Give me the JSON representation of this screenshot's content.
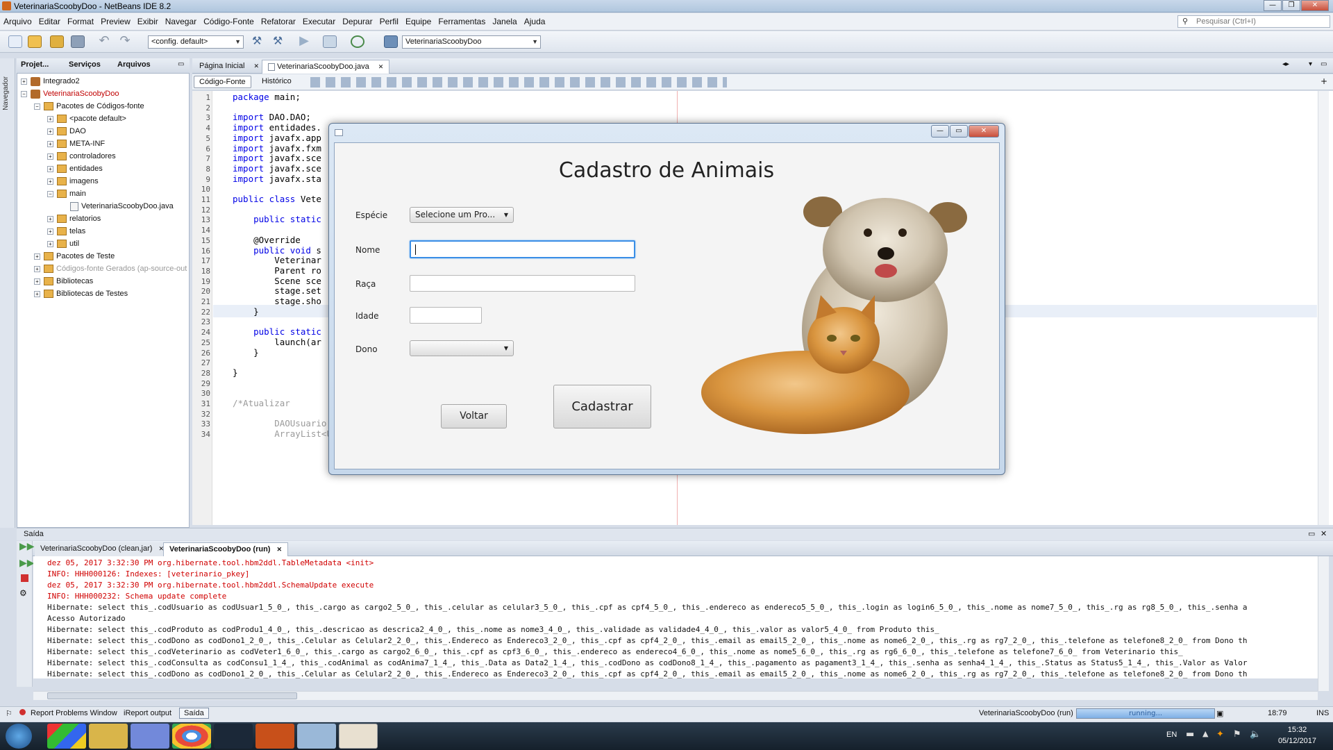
{
  "window": {
    "title": "VeterinariaScoobyDoo - NetBeans IDE 8.2"
  },
  "menu": [
    "Arquivo",
    "Editar",
    "Format",
    "Preview",
    "Exibir",
    "Navegar",
    "Código-Fonte",
    "Refatorar",
    "Executar",
    "Depurar",
    "Perfil",
    "Equipe",
    "Ferramentas",
    "Janela",
    "Ajuda"
  ],
  "search": {
    "placeholder": "Pesquisar (Ctrl+I)"
  },
  "toolbar": {
    "config": "<config. default>",
    "project_combo": "VeterinariaScoobyDoo"
  },
  "left_strip": {
    "navigator": "Navegador"
  },
  "project_panel": {
    "tabs": [
      "Projet...",
      "Serviços",
      "Arquivos"
    ],
    "tree": [
      {
        "label": "Integrado2",
        "kind": "project",
        "level": 0,
        "exp": "+"
      },
      {
        "label": "VeterinariaScoobyDoo",
        "kind": "project",
        "level": 0,
        "exp": "-",
        "color": "#c00000"
      },
      {
        "label": "Pacotes de Códigos-fonte",
        "kind": "package",
        "level": 1,
        "exp": "-"
      },
      {
        "label": "<pacote default>",
        "kind": "package",
        "level": 2,
        "exp": "+"
      },
      {
        "label": "DAO",
        "kind": "package",
        "level": 2,
        "exp": "+"
      },
      {
        "label": "META-INF",
        "kind": "package",
        "level": 2,
        "exp": "+"
      },
      {
        "label": "controladores",
        "kind": "package",
        "level": 2,
        "exp": "+"
      },
      {
        "label": "entidades",
        "kind": "package",
        "level": 2,
        "exp": "+"
      },
      {
        "label": "imagens",
        "kind": "package",
        "level": 2,
        "exp": "+"
      },
      {
        "label": "main",
        "kind": "package",
        "level": 2,
        "exp": "-"
      },
      {
        "label": "VeterinariaScoobyDoo.java",
        "kind": "file",
        "level": 3,
        "exp": ""
      },
      {
        "label": "relatorios",
        "kind": "package",
        "level": 2,
        "exp": "+"
      },
      {
        "label": "telas",
        "kind": "package",
        "level": 2,
        "exp": "+"
      },
      {
        "label": "util",
        "kind": "package",
        "level": 2,
        "exp": "+"
      },
      {
        "label": "Pacotes de Teste",
        "kind": "package",
        "level": 1,
        "exp": "+"
      },
      {
        "label": "Códigos-fonte Gerados (ap-source-out",
        "kind": "package",
        "level": 1,
        "exp": "+",
        "color": "#999999"
      },
      {
        "label": "Bibliotecas",
        "kind": "package",
        "level": 1,
        "exp": "+"
      },
      {
        "label": "Bibliotecas de Testes",
        "kind": "package",
        "level": 1,
        "exp": "+"
      }
    ]
  },
  "editor": {
    "tabs": [
      "Página Inicial",
      "VeterinariaScoobyDoo.java"
    ],
    "view_buttons": [
      "Código-Fonte",
      "Histórico"
    ],
    "lines": [
      {
        "n": "1",
        "text": "package main;",
        "kw": "package"
      },
      {
        "n": "2",
        "text": ""
      },
      {
        "n": "3",
        "text": "import DAO.DAO;",
        "kw": "import"
      },
      {
        "n": "4",
        "text": "import entidades.",
        "kw": "import"
      },
      {
        "n": "5",
        "text": "import javafx.app",
        "kw": "import"
      },
      {
        "n": "6",
        "text": "import javafx.fxm",
        "kw": "import"
      },
      {
        "n": "7",
        "text": "import javafx.sce",
        "kw": "import"
      },
      {
        "n": "8",
        "text": "import javafx.sce",
        "kw": "import"
      },
      {
        "n": "9",
        "text": "import javafx.sta",
        "kw": "import"
      },
      {
        "n": "10",
        "text": ""
      },
      {
        "n": "11",
        "text": "public class Vete",
        "kw": "public class"
      },
      {
        "n": "12",
        "text": ""
      },
      {
        "n": "13",
        "text": "    public static",
        "kw": "public static"
      },
      {
        "n": "14",
        "text": ""
      },
      {
        "n": "15",
        "text": "    @Override"
      },
      {
        "n": "16",
        "text": "    public void s",
        "kw": "public void"
      },
      {
        "n": "17",
        "text": "        Veterinar"
      },
      {
        "n": "18",
        "text": "        Parent ro"
      },
      {
        "n": "19",
        "text": "        Scene sce"
      },
      {
        "n": "20",
        "text": "        stage.set"
      },
      {
        "n": "21",
        "text": "        stage.sho"
      },
      {
        "n": "22",
        "text": "    }"
      },
      {
        "n": "23",
        "text": ""
      },
      {
        "n": "24",
        "text": "    public static",
        "kw": "public static"
      },
      {
        "n": "25",
        "text": "        launch(ar"
      },
      {
        "n": "26",
        "text": "    }"
      },
      {
        "n": "27",
        "text": ""
      },
      {
        "n": "28",
        "text": "}"
      },
      {
        "n": "29",
        "text": ""
      },
      {
        "n": "30",
        "text": ""
      },
      {
        "n": "31",
        "text": "/*Atualizar",
        "comment": true
      },
      {
        "n": "32",
        "text": ""
      },
      {
        "n": "33",
        "text": "        DAOUsuario dao = new DAOUsuario();",
        "comment": true
      },
      {
        "n": "34",
        "text": "        ArrayList<Usuario> lista;",
        "comment": true
      }
    ]
  },
  "dialog": {
    "title": "Cadastro de Animais",
    "labels": {
      "especie": "Espécie",
      "nome": "Nome",
      "raca": "Raça",
      "idade": "Idade",
      "dono": "Dono"
    },
    "especie_value": "Selecione um Pro...",
    "nome_value": "",
    "raca_value": "",
    "idade_value": "",
    "dono_value": "",
    "buttons": {
      "voltar": "Voltar",
      "cadastrar": "Cadastrar"
    }
  },
  "output": {
    "header": "Saída",
    "tabs": [
      "VeterinariaScoobyDoo (clean,jar)",
      "VeterinariaScoobyDoo (run)"
    ],
    "lines": [
      {
        "text": "dez 05, 2017 3:32:30 PM org.hibernate.tool.hbm2ddl.TableMetadata <init>",
        "red": true
      },
      {
        "text": "INFO: HHH000126: Indexes: [veterinario_pkey]",
        "red": true
      },
      {
        "text": "dez 05, 2017 3:32:30 PM org.hibernate.tool.hbm2ddl.SchemaUpdate execute",
        "red": true
      },
      {
        "text": "INFO: HHH000232: Schema update complete",
        "red": true
      },
      {
        "text": "Hibernate: select this_.codUsuario as codUsuar1_5_0_, this_.cargo as cargo2_5_0_, this_.celular as celular3_5_0_, this_.cpf as cpf4_5_0_, this_.endereco as endereco5_5_0_, this_.login as login6_5_0_, this_.nome as nome7_5_0_, this_.rg as rg8_5_0_, this_.senha a",
        "red": false
      },
      {
        "text": "Acesso Autorizado",
        "red": false
      },
      {
        "text": "Hibernate: select this_.codProduto as codProdu1_4_0_, this_.descricao as descrica2_4_0_, this_.nome as nome3_4_0_, this_.validade as validade4_4_0_, this_.valor as valor5_4_0_ from Produto this_",
        "red": false
      },
      {
        "text": "Hibernate: select this_.codDono as codDono1_2_0_, this_.Celular as Celular2_2_0_, this_.Endereco as Endereco3_2_0_, this_.cpf as cpf4_2_0_, this_.email as email5_2_0_, this_.nome as nome6_2_0_, this_.rg as rg7_2_0_, this_.telefone as telefone8_2_0_ from Dono th",
        "red": false
      },
      {
        "text": "Hibernate: select this_.codVeterinario as codVeter1_6_0_, this_.cargo as cargo2_6_0_, this_.cpf as cpf3_6_0_, this_.endereco as endereco4_6_0_, this_.nome as nome5_6_0_, this_.rg as rg6_6_0_, this_.telefone as telefone7_6_0_ from Veterinario this_",
        "red": false
      },
      {
        "text": "Hibernate: select this_.codConsulta as codConsu1_1_4_, this_.codAnimal as codAnima7_1_4_, this_.Data as Data2_1_4_, this_.codDono as codDono8_1_4_, this_.pagamento as pagament3_1_4_, this_.senha as senha4_1_4_, this_.Status as Status5_1_4_, this_.Valor as Valor",
        "red": false
      },
      {
        "text": "Hibernate: select this_.codDono as codDono1_2_0_, this_.Celular as Celular2_2_0_, this_.Endereco as Endereco3_2_0_, this_.cpf as cpf4_2_0_, this_.email as email5_2_0_, this_.nome as nome6_2_0_, this_.rg as rg7_2_0_, this_.telefone as telefone8_2_0_ from Dono th",
        "red": false
      }
    ]
  },
  "statusbar": {
    "items": [
      "Report Problems Window",
      "iReport output",
      "Saída"
    ],
    "running_project": "VeterinariaScoobyDoo (run)",
    "progress_text": "running...",
    "position": "18:79",
    "mode": "INS"
  },
  "taskbar": {
    "lang": "EN",
    "time": "15:32",
    "date": "05/12/2017"
  },
  "colors": {
    "accent": "#3a8ee6",
    "keyword": "#0000e6",
    "error_text": "#d00000"
  }
}
